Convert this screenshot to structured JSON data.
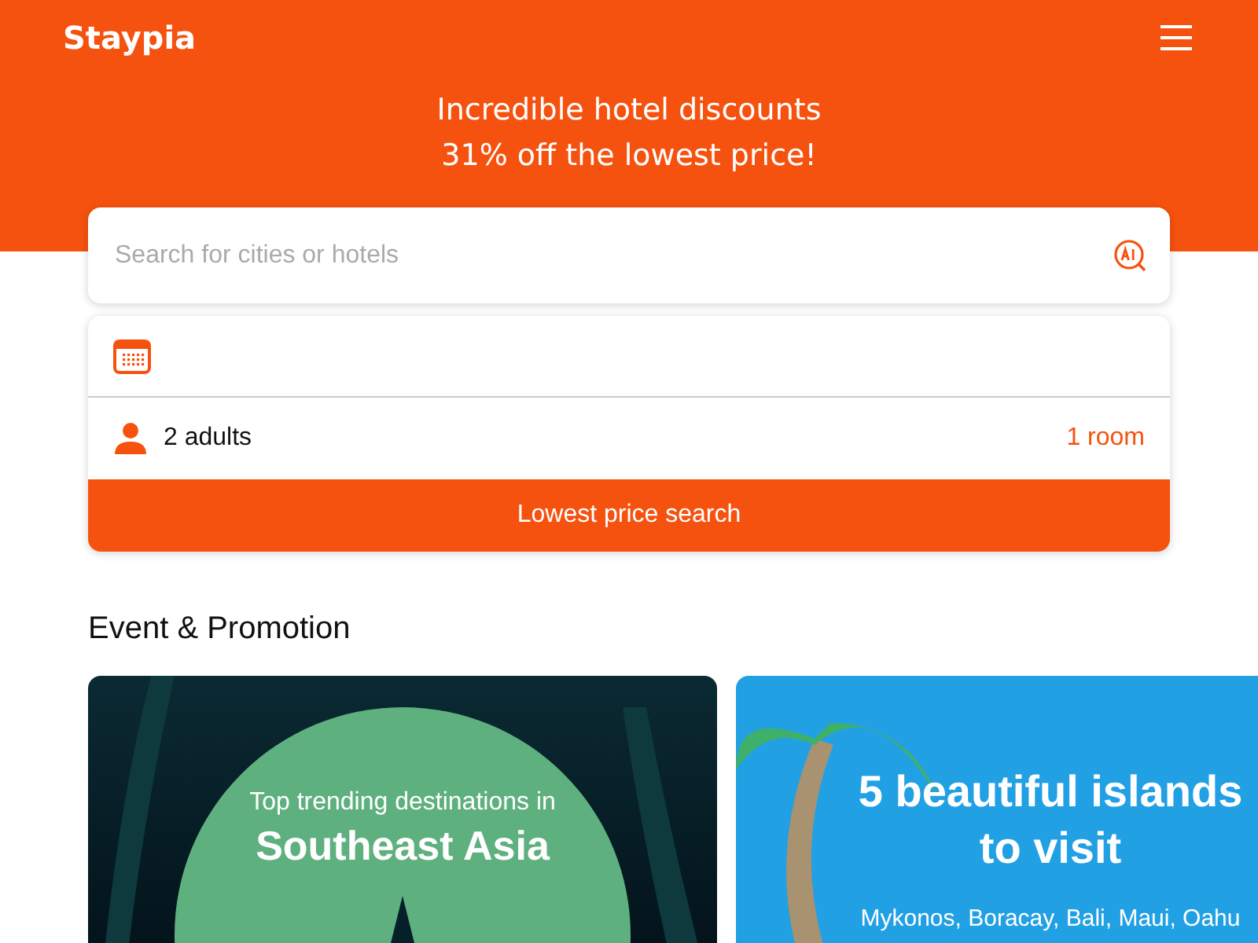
{
  "header": {
    "logo": "Staypia",
    "headline": [
      "Incredible hotel discounts",
      "31% off the lowest price!"
    ]
  },
  "search": {
    "placeholder": "Search for cities or hotels"
  },
  "booking": {
    "guests": "2 adults",
    "rooms": "1 room",
    "button": "Lowest price search"
  },
  "promotions": {
    "title": "Event & Promotion",
    "cards": [
      {
        "kind": "night",
        "subtitle": "Top trending destinations in",
        "title": "Southeast Asia"
      },
      {
        "kind": "beach",
        "title": "5 beautiful islands to visit",
        "subtitle": "Mykonos, Boracay, Bali, Maui, Oahu"
      }
    ]
  }
}
